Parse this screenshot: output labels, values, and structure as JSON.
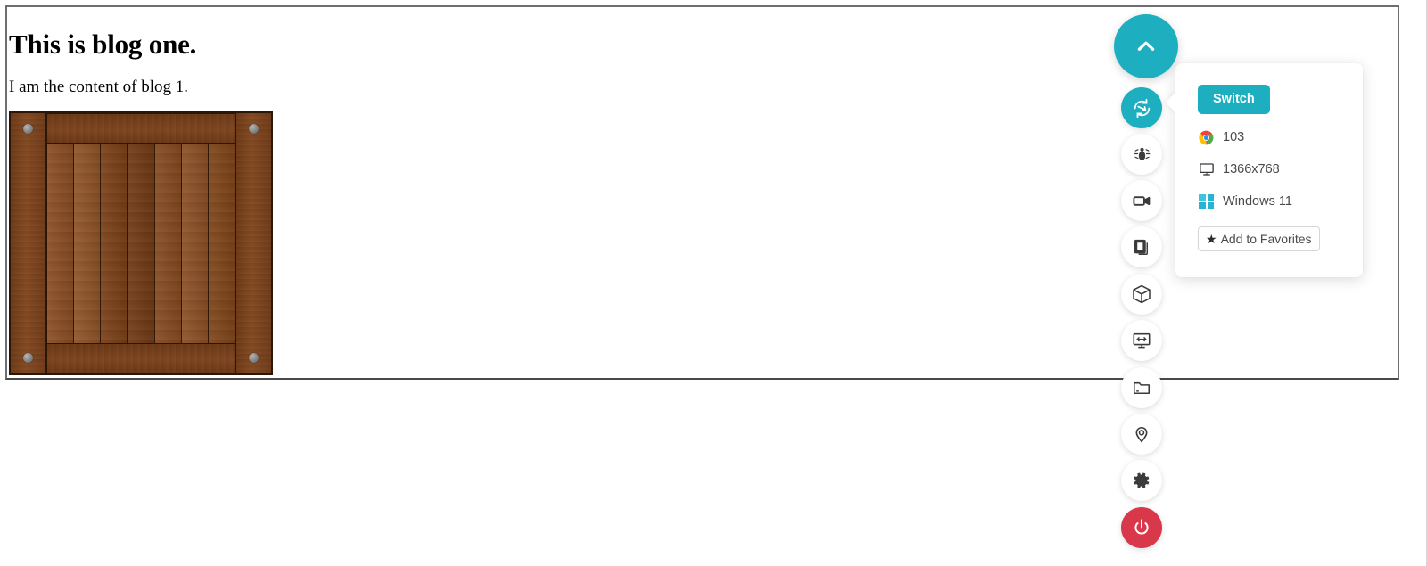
{
  "page": {
    "title": "This is blog one.",
    "body": "I am the content of blog 1."
  },
  "image": {
    "alt": "wooden-crate"
  },
  "sidebar": {
    "items": [
      {
        "name": "collapse-toggle",
        "icon": "chevron-up-icon",
        "style": "teal-large"
      },
      {
        "name": "switch-device",
        "icon": "switch-icon",
        "style": "teal"
      },
      {
        "name": "bug-report",
        "icon": "bug-icon",
        "style": "white"
      },
      {
        "name": "record-video",
        "icon": "video-camera-icon",
        "style": "white"
      },
      {
        "name": "screenshots",
        "icon": "copy-stack-icon",
        "style": "white"
      },
      {
        "name": "local-testing",
        "icon": "cube-icon",
        "style": "white"
      },
      {
        "name": "resolution",
        "icon": "monitor-resize-icon",
        "style": "white"
      },
      {
        "name": "file-manager",
        "icon": "folder-icon",
        "style": "white"
      },
      {
        "name": "geolocation",
        "icon": "location-pin-icon",
        "style": "white"
      },
      {
        "name": "settings",
        "icon": "gear-icon",
        "style": "white"
      },
      {
        "name": "stop-session",
        "icon": "power-icon",
        "style": "red"
      }
    ]
  },
  "panel": {
    "switch_label": "Switch",
    "browser": {
      "icon": "chrome-icon",
      "value": "103"
    },
    "resolution": {
      "icon": "monitor-icon",
      "value": "1366x768"
    },
    "os": {
      "icon": "windows-icon",
      "value": "Windows 11"
    },
    "favorites_label": "Add to Favorites",
    "favorites_icon": "star-icon"
  },
  "colors": {
    "accent": "#1dafbf",
    "danger": "#d8384a",
    "text": "#4a4a4a",
    "windows_blue": "#26b4d4"
  }
}
